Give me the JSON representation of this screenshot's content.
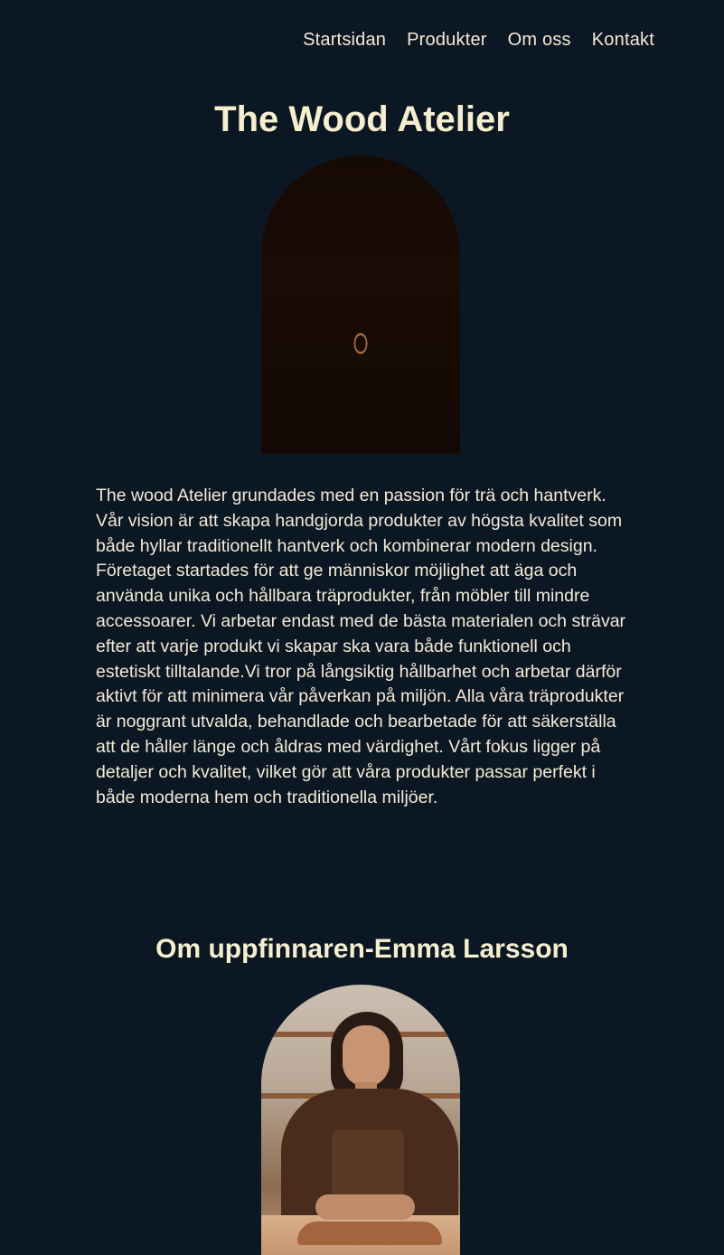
{
  "nav": {
    "items": [
      {
        "label": "Startsidan"
      },
      {
        "label": "Produkter"
      },
      {
        "label": "Om oss"
      },
      {
        "label": "Kontakt"
      }
    ]
  },
  "hero": {
    "title": "The Wood Atelier",
    "image_alt": "wood grain fingerprint"
  },
  "about": {
    "text": "The wood Atelier grundades med en passion för trä och hantverk. Vår vision är att skapa handgjorda produkter av högsta kvalitet som både hyllar traditionellt hantverk och kombinerar modern design. Företaget startades för att ge människor möjlighet att äga och använda unika och hållbara träprodukter, från möbler till mindre accessoarer. Vi arbetar endast med de bästa materialen och strävar efter att varje produkt vi skapar ska vara både funktionell och estetiskt tilltalande.Vi tror på långsiktig hållbarhet och arbetar därför aktivt för att minimera vår påverkan på miljön. Alla våra träprodukter är noggrant utvalda, behandlade och bearbetade för att säkerställa att de håller länge och åldras med värdighet. Vårt fokus ligger på detaljer och kvalitet, vilket gör att våra produkter passar perfekt i både moderna hem och traditionella miljöer."
  },
  "founder": {
    "heading": "Om uppfinnaren-Emma Larsson"
  },
  "colors": {
    "background": "#0c1724",
    "text": "#f4ead6",
    "heading": "#f6efcf",
    "wood": "#b27048"
  }
}
